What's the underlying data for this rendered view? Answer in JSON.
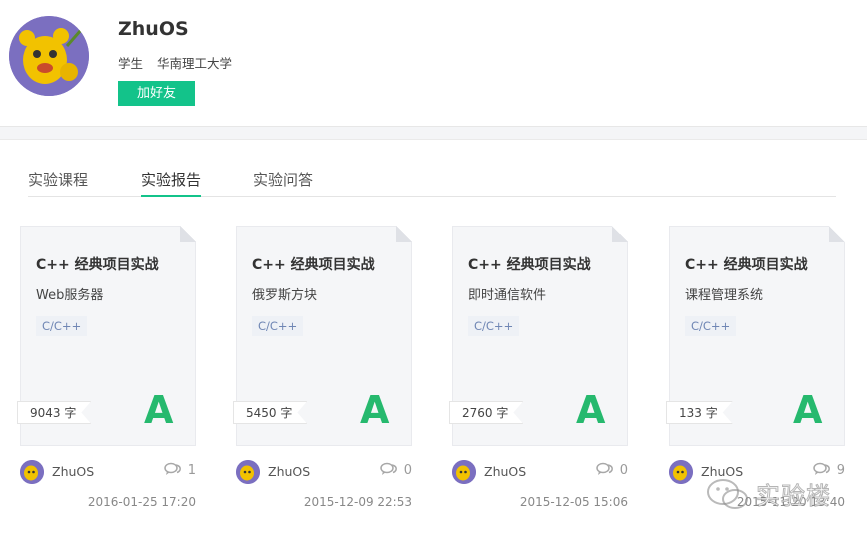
{
  "profile": {
    "name": "ZhuOS",
    "role": "学生",
    "school": "华南理工大学",
    "add_friend": "加好友"
  },
  "tabs": [
    "实验课程",
    "实验报告",
    "实验问答"
  ],
  "active_tab": 1,
  "colors": {
    "accent": "#13c38a",
    "grade": "#26b96e",
    "tag": "#6f86b4"
  },
  "cards": [
    {
      "course": "C++ 经典项目实战",
      "topic": "Web服务器",
      "tag": "C/C++",
      "words": "9043 字",
      "grade": "A",
      "author": "ZhuOS",
      "comments": "1",
      "date": "2016-01-25 17:20"
    },
    {
      "course": "C++ 经典项目实战",
      "topic": "俄罗斯方块",
      "tag": "C/C++",
      "words": "5450 字",
      "grade": "A",
      "author": "ZhuOS",
      "comments": "0",
      "date": "2015-12-09 22:53"
    },
    {
      "course": "C++ 经典项目实战",
      "topic": "即时通信软件",
      "tag": "C/C++",
      "words": "2760 字",
      "grade": "A",
      "author": "ZhuOS",
      "comments": "0",
      "date": "2015-12-05 15:06"
    },
    {
      "course": "C++ 经典项目实战",
      "topic": "课程管理系统",
      "tag": "C/C++",
      "words": "133 字",
      "grade": "A",
      "author": "ZhuOS",
      "comments": "9",
      "date": "2015-11-20 13:40"
    }
  ],
  "watermark": "实验楼",
  "icons": {
    "comment": "comment-icon",
    "wechat": "wechat-icon"
  }
}
